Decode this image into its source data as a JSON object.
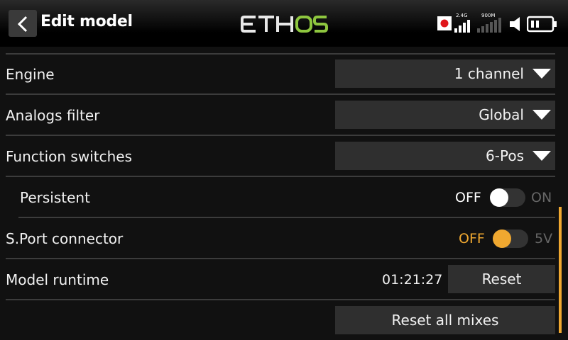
{
  "header": {
    "title": "Edit model",
    "logo_text": "ETHOS",
    "status": {
      "rf_band_1": "2.4G",
      "rf_band_2": "900M",
      "icons": [
        "record-icon",
        "signal-2g4-icon",
        "signal-900m-icon",
        "speaker-icon",
        "battery-icon"
      ]
    }
  },
  "settings": {
    "engine": {
      "label": "Engine",
      "value": "1 channel"
    },
    "analogs_filter": {
      "label": "Analogs filter",
      "value": "Global"
    },
    "function_switches": {
      "label": "Function switches",
      "value": "6-Pos"
    },
    "persistent": {
      "label": "Persistent",
      "off_label": "OFF",
      "on_label": "ON",
      "state": "off"
    },
    "sport_connector": {
      "label": "S.Port connector",
      "off_label": "OFF",
      "on_label": "5V",
      "state": "off"
    },
    "model_runtime": {
      "label": "Model runtime",
      "value": "01:21:27",
      "reset_label": "Reset"
    },
    "reset_all_mixes": {
      "label": "Reset all mixes"
    }
  },
  "colors": {
    "accent": "#f0a830",
    "logo_green": "#8ec63f",
    "record_red": "#e0161b"
  }
}
